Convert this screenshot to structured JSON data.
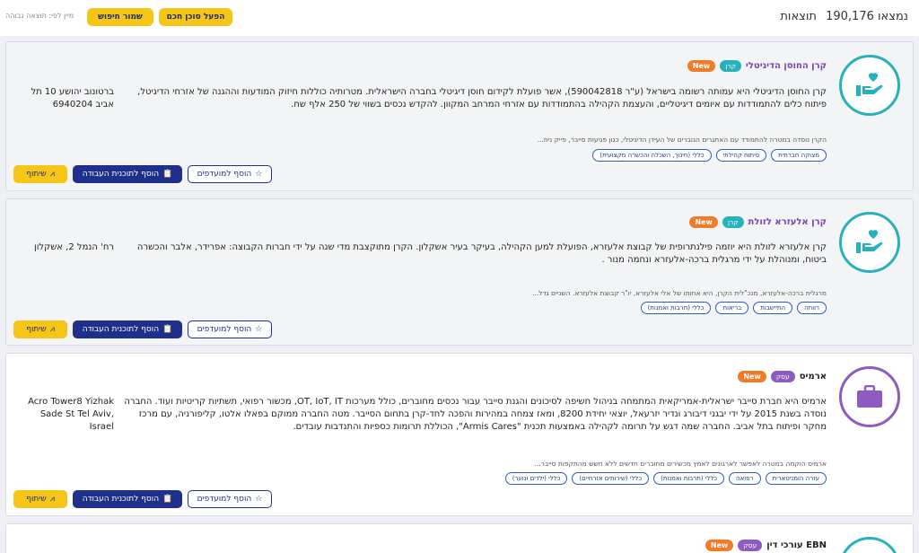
{
  "header": {
    "results_label": "נמצאו",
    "results_count": "190,176",
    "results_unit": "תוצאות",
    "smart_agent_button": "הפעל סוכן חכם",
    "save_search_button": "שמור חיפוש",
    "sort_label": "מיין לפי: תוצאה גבוהה"
  },
  "common": {
    "new_badge": "New",
    "share_button": "שיתוף",
    "add_to_plan_button": "הוסף לתוכנית העבודה",
    "add_to_favorites_button": "הוסף למועדפים"
  },
  "cards": [
    {
      "title": "קרן החוסן הדיגיטלי",
      "type_tag": "קרן",
      "description": "קרן החוסן הדיגיטלי היא עמותה רשומה בישראל (ע\"ר 590042818), אשר פועלת לקידום חוסן דיגיטלי בחברה הישראלית. מטרותיה כוללות חיזוק המודעות וההגנה של אזרחי הדיגיטל, פיתוח כלים להתמודדות עם איומים דיגיטליים, והעצמת הקהילה בהתמודדות עם אזרחי המרחב המקוון. להקדש נכסים בשווי של 250 אלף שח.",
      "address": "ברטונוב יהושע 10 תל אביב 6940204",
      "summary": "הקרן נוסדה במטרה להתמודד עם האתגרים הגוברים של העידן הדיגיטלי, כגון פגיעות סייבר, פייק ניוז...",
      "chips": [
        "מצוקה חברתית",
        "פיתוח קהילתי",
        "כללי (חינוך, השכלה והכשרה מקצועית)"
      ]
    },
    {
      "title": "קרן אלעזרא לזולת",
      "type_tag": "קרן",
      "description": "קרן אלעזרא לזולת היא יוזמה פילנתרופית של קבוצת אלעזרא, הפועלת למען הקהילה, בעיקר בעיר אשקלון. הקרן מתוקצבת מדי שנה על ידי חברות הקבוצה: אפרידר, אלבר והכשרה ביטוח, ומנוהלת על ידי מרגלית ברכה-אלעזרא ונחמה מנור .",
      "address": "רח' הנמל 2, אשקלון",
      "summary": "מרגלית ברכה-אלעזרא, מנכ\"לית הקרן, היא אחותו של אלי אלעזרא, יו\"ר קבוצת אלעזרא. השניים גדל...",
      "chips": [
        "רווחה",
        "התיישבות",
        "בריאות",
        "כללי (תרבות ואמנות)"
      ]
    },
    {
      "title": "ארמיס",
      "type_tag": "עסק",
      "description": "ארמיס היא חברת סייבר ישראלית-אמריקאית המתמחה בניהול חשיפה לסיכונים והגנת סייבר עבור נכסים מחוברים, כולל מערכות OT, IoT, IT, מכשור רפואי, תשתיות קריטיות ועוד. החברה נוסדה בשנת 2015 על ידי יבגני דיבורג ונדיר יזרעאל, יוצאי יחידת 8200, ומאז צמחה במהירות והפכה לחד-קרן בתחום הסייבר. מטה החברה ממוקם בפאלו אלטו, קליפורניה, עם מרכז מחקר ופיתוח בתל אביב. החברה שמה דגש על תרומה לקהילה באמצעות תכנית \"Armis Cares\", הכוללת תרומות כספיות והתנדבות עובדים.",
      "address": "Acro Tower8 Yizhak Sade St Tel Aviv, Israel",
      "summary": "ארמיס הוקמה במטרה לאפשר לארגונים לאמץ מכשירים מחוברים חדשים ללא חשש מהתקפות סייבר...",
      "chips": [
        "עזרה הומניטארית",
        "רפואה",
        "כללי (תרבות ואמנות)",
        "כללי (שירותים אזרחיים)",
        "כללי (ילדים ונוער)"
      ]
    },
    {
      "title": "EBN עורכי דין",
      "type_tag": "עסק"
    }
  ],
  "colors": {
    "teal": "#27b1bd",
    "purple": "#8e5cc0",
    "yellow": "#f5c518",
    "navy": "#1f2f8c",
    "orange": "#f07c27"
  },
  "icons": [
    "hand-heart-icon",
    "briefcase-icon",
    "share-icon",
    "clipboard-icon",
    "star-icon"
  ]
}
